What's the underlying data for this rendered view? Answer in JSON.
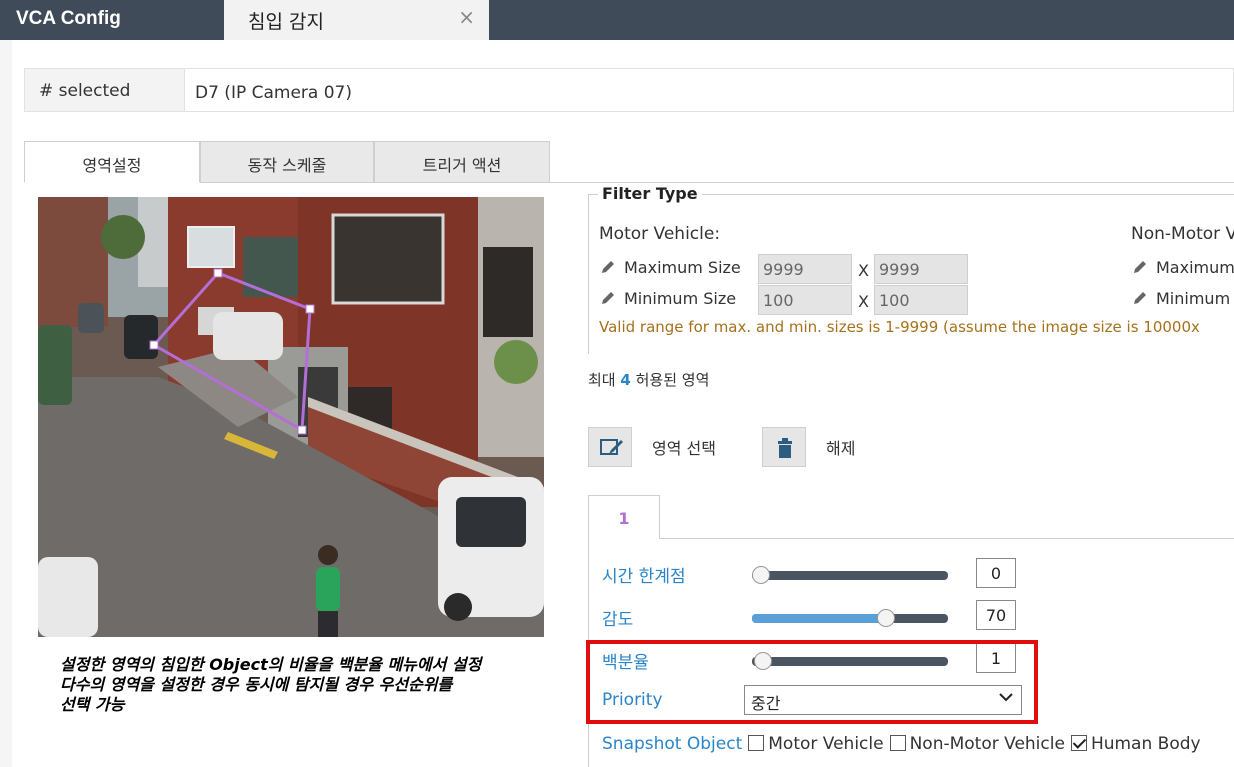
{
  "app_title": "VCA Config",
  "tab": {
    "label": "침입 감지",
    "close": "×"
  },
  "selected": {
    "label": "# selected",
    "value": "D7 (IP Camera 07)"
  },
  "subtabs": [
    "영역설정",
    "동작 스케줄",
    "트리거 액션"
  ],
  "caption": {
    "line1": "설정한 영역의 침입한 Object의 비율을 백분율 메뉴에서 설정",
    "line2": "다수의 영역을 설정한 경우 동시에 탐지될 경우 우선순위를",
    "line3": "선택 가능"
  },
  "filter": {
    "legend": "Filter Type",
    "motor_vehicle": "Motor Vehicle:",
    "non_motor": "Non-Motor V",
    "max_label": "Maximum Size",
    "min_label": "Minimum Size",
    "max_label_trunc": "Maximum",
    "min_label_trunc": "Minimum",
    "max_w": "9999",
    "max_h": "9999",
    "min_w": "100",
    "min_h": "100",
    "x": "X",
    "note": "Valid range for max. and min. sizes is 1-9999 (assume the image size is 10000x"
  },
  "max_areas": {
    "prefix": "최대",
    "count": "4",
    "suffix": "허용된 영역"
  },
  "buttons": {
    "select_area": "영역 선택",
    "clear": "해제"
  },
  "area_tab": "1",
  "params": {
    "time_threshold": {
      "label": "시간 한계점",
      "value": "0",
      "level": 0
    },
    "sensitivity": {
      "label": "감도",
      "value": "70",
      "level": 70
    },
    "percentage": {
      "label": "백분율",
      "value": "1",
      "level": 1
    },
    "priority": {
      "label": "Priority",
      "value": "중간"
    }
  },
  "snapshot": {
    "label": "Snapshot Object",
    "motor_vehicle": "Motor Vehicle",
    "non_motor_vehicle": "Non-Motor Vehicle",
    "human_body": "Human Body",
    "motor_checked": false,
    "non_motor_checked": false,
    "human_checked": true
  },
  "colors": {
    "accent": "#2a85c8",
    "highlight": "#e00d0d",
    "area_polygon": "#b36fd6",
    "note": "#a6711c"
  }
}
